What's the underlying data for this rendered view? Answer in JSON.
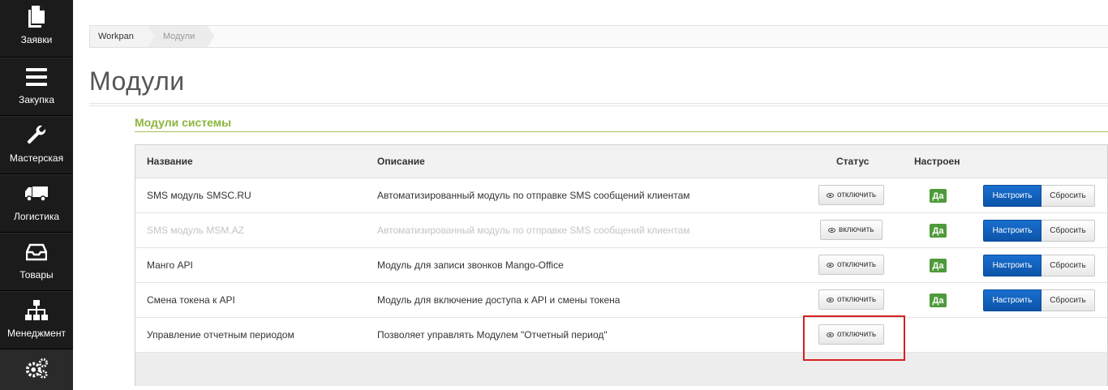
{
  "sidebar": {
    "items": [
      {
        "label": "Заявки",
        "icon": "documents-icon"
      },
      {
        "label": "Закупка",
        "icon": "menu-bars-icon"
      },
      {
        "label": "Мастерская",
        "icon": "wrench-icon"
      },
      {
        "label": "Логистика",
        "icon": "truck-icon"
      },
      {
        "label": "Товары",
        "icon": "inbox-icon"
      },
      {
        "label": "Менеджмент",
        "icon": "org-chart-icon"
      },
      {
        "label": "",
        "icon": "gears-icon"
      }
    ]
  },
  "breadcrumb": {
    "items": [
      "Workpan",
      "Модули"
    ]
  },
  "page": {
    "title": "Модули",
    "section_title": "Модули системы"
  },
  "table": {
    "headers": {
      "name": "Название",
      "description": "Описание",
      "status": "Статус",
      "configured": "Настроен"
    },
    "rows": [
      {
        "name": "SMS модуль SMSC.RU",
        "description": "Автоматизированный модуль по отправке SMS сообщений клиентам",
        "toggle": "отключить",
        "configured": "Да",
        "configure": "Настроить",
        "reset": "Сбросить"
      },
      {
        "name": "SMS модуль MSM.AZ",
        "description": "Автоматизированный модуль по отправке SMS сообщений клиентам",
        "toggle": "включить",
        "configured": "Да",
        "configure": "Настроить",
        "reset": "Сбросить"
      },
      {
        "name": "Манго API",
        "description": "Модуль для записи звонков Mango-Office",
        "toggle": "отключить",
        "configured": "Да",
        "configure": "Настроить",
        "reset": "Сбросить"
      },
      {
        "name": "Смена токена к API",
        "description": "Модуль для включение доступа к API и смены токена",
        "toggle": "отключить",
        "configured": "Да",
        "configure": "Настроить",
        "reset": "Сбросить"
      },
      {
        "name": "Управление отчетным периодом",
        "description": "Позволяет управлять Модулем \"Отчетный период\"",
        "toggle": "отключить"
      }
    ]
  },
  "colors": {
    "sidebar_bg": "#1b1b1b",
    "accent_green": "#8cb53c",
    "badge_green": "#4e9a3a",
    "primary_blue": "#0c54a8",
    "highlight_red": "#d42020"
  }
}
